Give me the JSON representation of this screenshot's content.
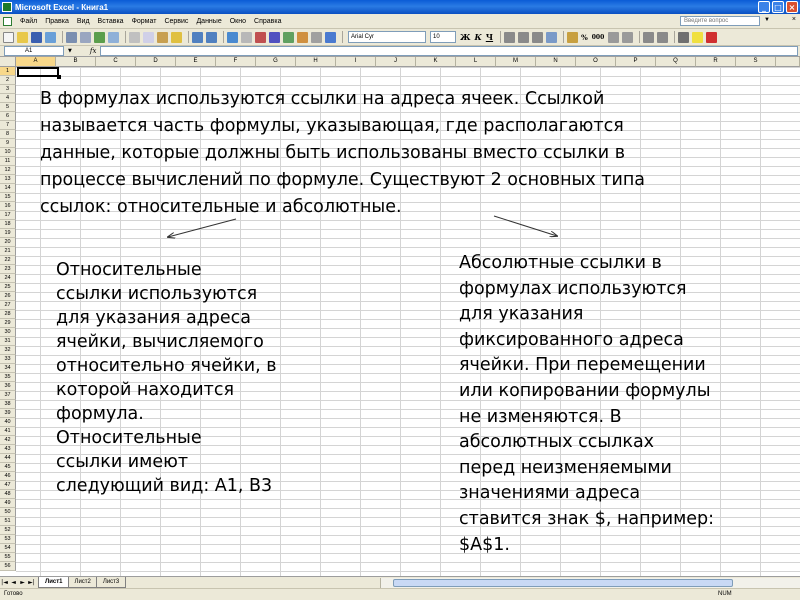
{
  "window": {
    "title": "Microsoft Excel - Книга1"
  },
  "menu": {
    "items": [
      "Файл",
      "Правка",
      "Вид",
      "Вставка",
      "Формат",
      "Сервис",
      "Данные",
      "Окно",
      "Справка"
    ],
    "help_placeholder": "Введите вопрос",
    "close_glyph": "×"
  },
  "toolbar": {
    "font_name": "Arial Cyr",
    "font_size": "10",
    "bold": "Ж",
    "italic": "К",
    "underline": "Ч",
    "percent": "%",
    "thousands": "000"
  },
  "formula_bar": {
    "name_box": "A1",
    "fx": "fx"
  },
  "columns": [
    "A",
    "B",
    "C",
    "D",
    "E",
    "F",
    "G",
    "H",
    "I",
    "J",
    "K",
    "L",
    "M",
    "N",
    "O",
    "P",
    "Q",
    "R",
    "S"
  ],
  "active_cell": "A1",
  "content": {
    "intro_lines": [
      "В формулах используются ссылки на адреса ячеек. Ссылкой",
      "называется часть формулы, указывающая, где располагаются",
      "данные, которые должны быть использованы вместо ссылки в",
      "процессе вычислений по формуле. Существуют 2 основных типа",
      "ссылок: относительные и абсолютные."
    ],
    "relative_lines": [
      "Относительные",
      "ссылки используются",
      "для указания адреса",
      "ячейки, вычисляемого",
      "относительно ячейки, в",
      "которой находится",
      "формула.",
      "Относительные",
      "ссылки имеют",
      "следующий вид: A1, B3"
    ],
    "absolute_lines": [
      "Абсолютные ссылки в",
      "формулах используются",
      "для указания",
      "фиксированного адреса",
      "ячейки. При перемещении",
      "или копировании формулы",
      "не изменяются. В",
      "абсолютных ссылках",
      "перед неизменяемыми",
      "значениями адреса",
      "ставится знак $, например:",
      "$A$1."
    ]
  },
  "sheet_tabs": [
    "Лист1",
    "Лист2",
    "Лист3"
  ],
  "status": {
    "left": "Готово",
    "right": "NUM"
  },
  "colors": {
    "title_bar": "#0a5bd6",
    "chrome": "#ece9d8",
    "active_header": "#f8d88a",
    "grid": "#d4d4d4"
  }
}
